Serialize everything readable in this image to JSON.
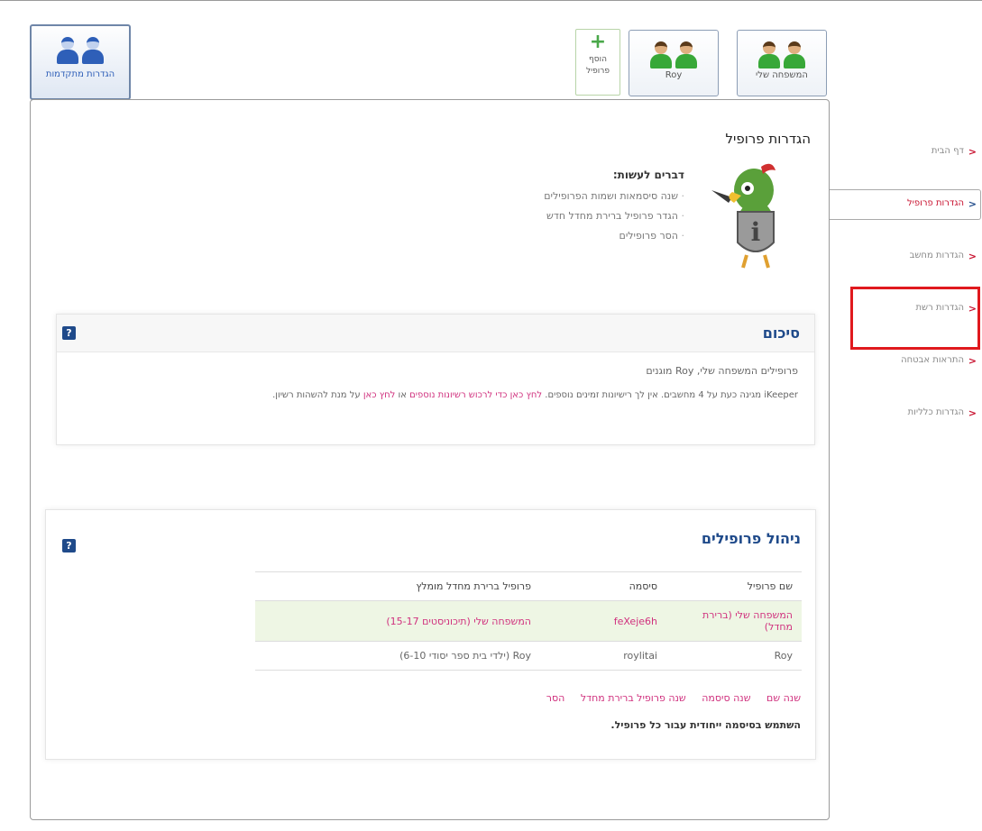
{
  "tiles": {
    "advanced": "הגדרות מתקדמות",
    "add_profile_line1": "הוסף",
    "add_profile_line2": "פרופיל",
    "add_plus": "+",
    "roy": "Roy",
    "family": "המשפחה שלי"
  },
  "header": {
    "page_title": "הגדרות פרופיל",
    "todo_title": "דברים לעשות:",
    "todo_items": [
      "שנה סיסמאות ושמות הפרופילים",
      "הגדר פרופיל ברירת מחדל חדש",
      "הסר פרופילים"
    ]
  },
  "summary": {
    "title": "סיכום",
    "help": "?",
    "line1": "פרופילים המשפחה שלי, Roy מוגנים",
    "line2_a": "iKeeper מגינה כעת על 4 מחשבים. אין לך רישיונות זמינים נוספים.",
    "line2_link1": "לחץ כאן כדי לרכוש רשיונות נוספים",
    "line2_b": "או",
    "line2_link2": "לחץ כאן",
    "line2_c": "על מנת להשהות רשיון."
  },
  "profiles": {
    "title": "ניהול פרופילים",
    "help": "?",
    "columns": [
      "שם פרופיל",
      "סיסמה",
      "פרופיל ברירת מחדל מומלץ"
    ],
    "rows": [
      [
        "המשפחה שלי (ברירת מחדל)",
        "feXeje6h",
        "המשפחה שלי (תיכוניסטים 15-17)"
      ],
      [
        "Roy",
        "roylitai",
        "Roy (ילדי בית ספר יסודי 6-10)"
      ]
    ],
    "actions": [
      "שנה שם",
      "שנה סיסמה",
      "שנה פרופיל ברירת מחדל",
      "הסר"
    ],
    "note": "השתמש בסיסמה ייחודית עבור כל פרופיל."
  },
  "nav": {
    "items": [
      "דף הבית",
      "הגדרות פרופיל",
      "הגדרות מחשב",
      "הגדרות רשת",
      "התראות אבטחה",
      "הגדרות כלליות"
    ],
    "arrow": "<",
    "active_index": 1
  },
  "colors": {
    "accent": "#1f4a8a",
    "link": "#d0317e",
    "nav_arrow": "#c8102e",
    "highlight": "#e0191e"
  }
}
